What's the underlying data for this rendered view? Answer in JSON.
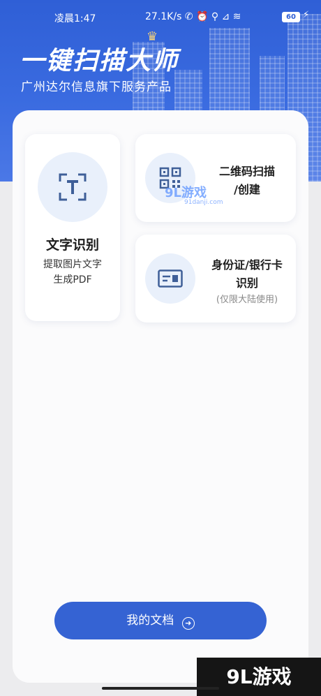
{
  "status_bar": {
    "time": "凌晨1:47",
    "right_text": "27.1K/s ✆ ⏰ ⚲ ⊿ ≋",
    "battery": "60",
    "charging_icon": "bolt-icon"
  },
  "header": {
    "app_title": "一键扫描大师",
    "subtitle": "广州达尔信息旗下服务产品"
  },
  "features": {
    "text_recognition": {
      "title": "文字识别",
      "desc_line1": "提取图片文字",
      "desc_line2": "生成PDF",
      "icon": "text-scan-icon"
    },
    "qr_code": {
      "title_line1": "二维码扫描",
      "title_line2": "/创建",
      "icon": "qr-code-icon"
    },
    "id_card": {
      "title_line1": "身份证/银行卡",
      "title_line2": "识别",
      "note": "(仅限大陆使用)",
      "icon": "id-card-icon"
    }
  },
  "my_docs_button": {
    "label": "我的文档",
    "icon": "arrow-right-circle-icon"
  },
  "watermarks": {
    "mid_brand": "9L游戏",
    "mid_url": "91danji.com",
    "corner_brand": "9L游戏"
  },
  "colors": {
    "primary": "#3563d3",
    "header_bg": "#2f5fd6",
    "icon_bg": "#e9f0fb"
  }
}
